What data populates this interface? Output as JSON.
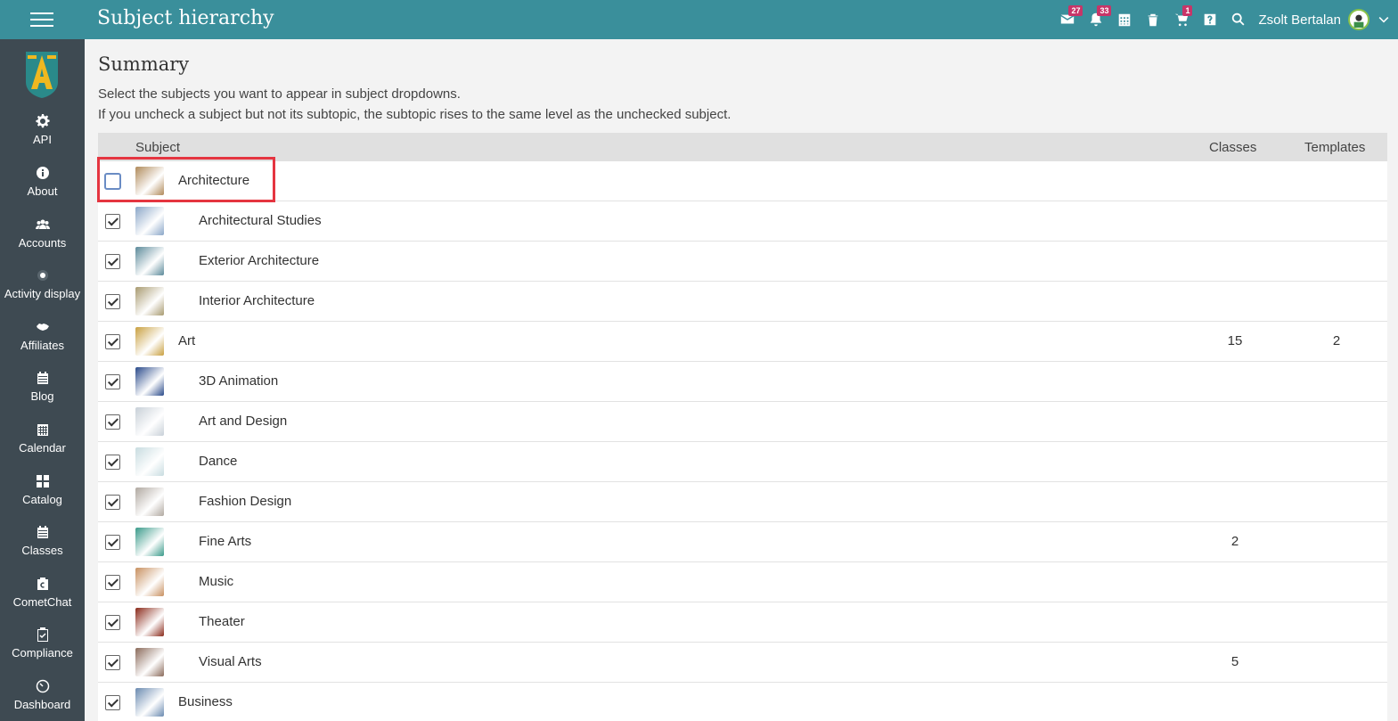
{
  "header": {
    "title": "Subject hierarchy",
    "messages_badge": "27",
    "notifications_badge": "33",
    "cart_badge": "1",
    "user_name": "Zsolt Bertalan"
  },
  "sidebar": {
    "items": [
      {
        "label": "API",
        "icon": "gear-icon"
      },
      {
        "label": "About",
        "icon": "info-icon"
      },
      {
        "label": "Accounts",
        "icon": "users-icon"
      },
      {
        "label": "Activity display",
        "icon": "dot-circle-icon"
      },
      {
        "label": "Affiliates",
        "icon": "handshake-icon"
      },
      {
        "label": "Blog",
        "icon": "calendar-icon"
      },
      {
        "label": "Calendar",
        "icon": "grid-calendar-icon"
      },
      {
        "label": "Catalog",
        "icon": "grid-icon"
      },
      {
        "label": "Classes",
        "icon": "calendar-icon"
      },
      {
        "label": "CometChat",
        "icon": "cometchat-icon"
      },
      {
        "label": "Compliance",
        "icon": "clipboard-check-icon"
      },
      {
        "label": "Dashboard",
        "icon": "speedometer-icon"
      }
    ]
  },
  "main": {
    "title": "Summary",
    "desc1": "Select the subjects you want to appear in subject dropdowns.",
    "desc2": "If you uncheck a subject but not its subtopic, the subtopic rises to the same level as the unchecked subject.",
    "columns": {
      "subject": "Subject",
      "classes": "Classes",
      "templates": "Templates"
    },
    "rows": [
      {
        "name": "Architecture",
        "level": 0,
        "checked": false,
        "classes": "",
        "templates": "",
        "color": "#b08a5a"
      },
      {
        "name": "Architectural Studies",
        "level": 1,
        "checked": true,
        "classes": "",
        "templates": "",
        "color": "#8aa6c8"
      },
      {
        "name": "Exterior Architecture",
        "level": 1,
        "checked": true,
        "classes": "",
        "templates": "",
        "color": "#5c8a9a"
      },
      {
        "name": "Interior Architecture",
        "level": 1,
        "checked": true,
        "classes": "",
        "templates": "",
        "color": "#a89a70"
      },
      {
        "name": "Art",
        "level": 0,
        "checked": true,
        "classes": "15",
        "templates": "2",
        "color": "#c9a040"
      },
      {
        "name": "3D Animation",
        "level": 1,
        "checked": true,
        "classes": "",
        "templates": "",
        "color": "#2a4a8a"
      },
      {
        "name": "Art and Design",
        "level": 1,
        "checked": true,
        "classes": "",
        "templates": "",
        "color": "#c8d0d8"
      },
      {
        "name": "Dance",
        "level": 1,
        "checked": true,
        "classes": "",
        "templates": "",
        "color": "#c8dce0"
      },
      {
        "name": "Fashion Design",
        "level": 1,
        "checked": true,
        "classes": "",
        "templates": "",
        "color": "#b0a8a0"
      },
      {
        "name": "Fine Arts",
        "level": 1,
        "checked": true,
        "classes": "2",
        "templates": "",
        "color": "#3a9a8a"
      },
      {
        "name": "Music",
        "level": 1,
        "checked": true,
        "classes": "",
        "templates": "",
        "color": "#c89060"
      },
      {
        "name": "Theater",
        "level": 1,
        "checked": true,
        "classes": "",
        "templates": "",
        "color": "#8a2a1a"
      },
      {
        "name": "Visual Arts",
        "level": 1,
        "checked": true,
        "classes": "5",
        "templates": "",
        "color": "#8a6a5a"
      },
      {
        "name": "Business",
        "level": 0,
        "checked": true,
        "classes": "",
        "templates": "",
        "color": "#6a8ab0"
      }
    ]
  },
  "colors": {
    "topbar": "#3a8f9b",
    "sidebar": "#3e4a52",
    "badge": "#c73568",
    "highlight": "#e53540"
  }
}
